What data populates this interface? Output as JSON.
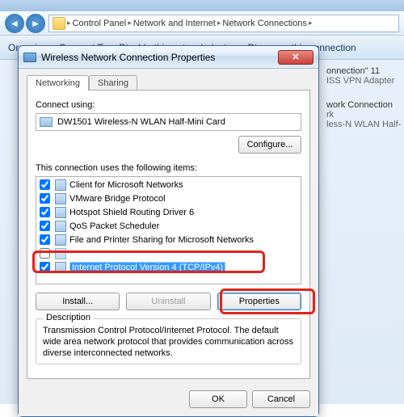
{
  "bg": {
    "breadcrumb": [
      "Control Panel",
      "Network and Internet",
      "Network Connections"
    ],
    "commands": [
      "Organize",
      "Connect To",
      "Disable this network device",
      "Diagnose this connection"
    ],
    "side": {
      "conn_name": "onnection\" 11",
      "adapter_type": "ISS VPN Adapter",
      "item2_title": "work Connection",
      "item2_sub": "rk",
      "item2_dev": "less-N WLAN Half-…"
    }
  },
  "dialog": {
    "title": "Wireless Network Connection Properties",
    "tabs": {
      "networking": "Networking",
      "sharing": "Sharing"
    },
    "connect_using_label": "Connect using:",
    "adapter": "DW1501 Wireless-N WLAN Half-Mini Card",
    "configure": "Configure...",
    "items_label": "This connection uses the following items:",
    "items": [
      {
        "label": "Client for Microsoft Networks",
        "checked": true
      },
      {
        "label": "VMware Bridge Protocol",
        "checked": true
      },
      {
        "label": "Hotspot Shield Routing Driver 6",
        "checked": true
      },
      {
        "label": "QoS Packet Scheduler",
        "checked": true
      },
      {
        "label": "File and Printer Sharing for Microsoft Networks",
        "checked": true
      },
      {
        "label": "",
        "checked": false
      },
      {
        "label": "Internet Protocol Version 4 (TCP/IPv4)",
        "checked": true,
        "selected": true
      }
    ],
    "install": "Install...",
    "uninstall": "Uninstall",
    "properties": "Properties",
    "description_legend": "Description",
    "description": "Transmission Control Protocol/Internet Protocol. The default wide area network protocol that provides communication across diverse interconnected networks.",
    "ok": "OK",
    "cancel": "Cancel"
  }
}
